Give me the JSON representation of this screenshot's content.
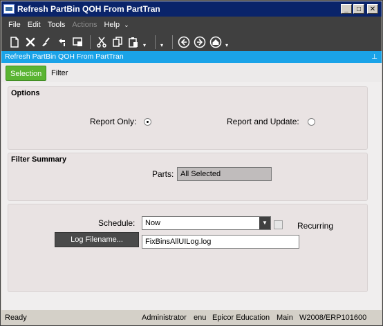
{
  "window": {
    "title": "Refresh PartBin QOH From PartTran",
    "min_glyph": "_",
    "max_glyph": "□",
    "close_glyph": "✕"
  },
  "menu": {
    "items": [
      {
        "label": "File",
        "enabled": true
      },
      {
        "label": "Edit",
        "enabled": true
      },
      {
        "label": "Tools",
        "enabled": true
      },
      {
        "label": "Actions",
        "enabled": false
      },
      {
        "label": "Help",
        "enabled": true
      }
    ],
    "overflow_glyph": "⌄"
  },
  "toolbar": {
    "icons": [
      "new-icon",
      "delete-icon",
      "clear-icon",
      "refresh-icon",
      "print-preview-icon",
      "cut-icon",
      "copy-icon",
      "paste-icon",
      "back-icon",
      "forward-icon",
      "home-icon"
    ],
    "dropdown_glyph": "▾"
  },
  "caption": {
    "title": "Refresh PartBin QOH From PartTran",
    "pin_glyph": "⊥"
  },
  "tabs": [
    {
      "label": "Selection",
      "active": true
    },
    {
      "label": "Filter",
      "active": false
    }
  ],
  "options": {
    "title": "Options",
    "report_only_label": "Report Only:",
    "report_and_update_label": "Report and Update:",
    "selected": "report_only"
  },
  "filter_summary": {
    "title": "Filter Summary",
    "parts_label": "Parts:",
    "parts_value": "All Selected"
  },
  "schedule": {
    "schedule_label": "Schedule:",
    "schedule_value": "Now",
    "recurring_label": "Recurring",
    "recurring_checked": false,
    "log_button_label": "Log Filename...",
    "log_filename": "FixBinsAllUILog.log"
  },
  "status": {
    "state": "Ready",
    "user": "Administrator",
    "language": "enu",
    "company": "Epicor Education",
    "site": "Main",
    "server": "W2008/ERP101600"
  },
  "colors": {
    "title_bar": "#0a246a",
    "caption_bar": "#1aa3e8",
    "active_tab": "#5ab432",
    "toolbar": "#404040"
  }
}
